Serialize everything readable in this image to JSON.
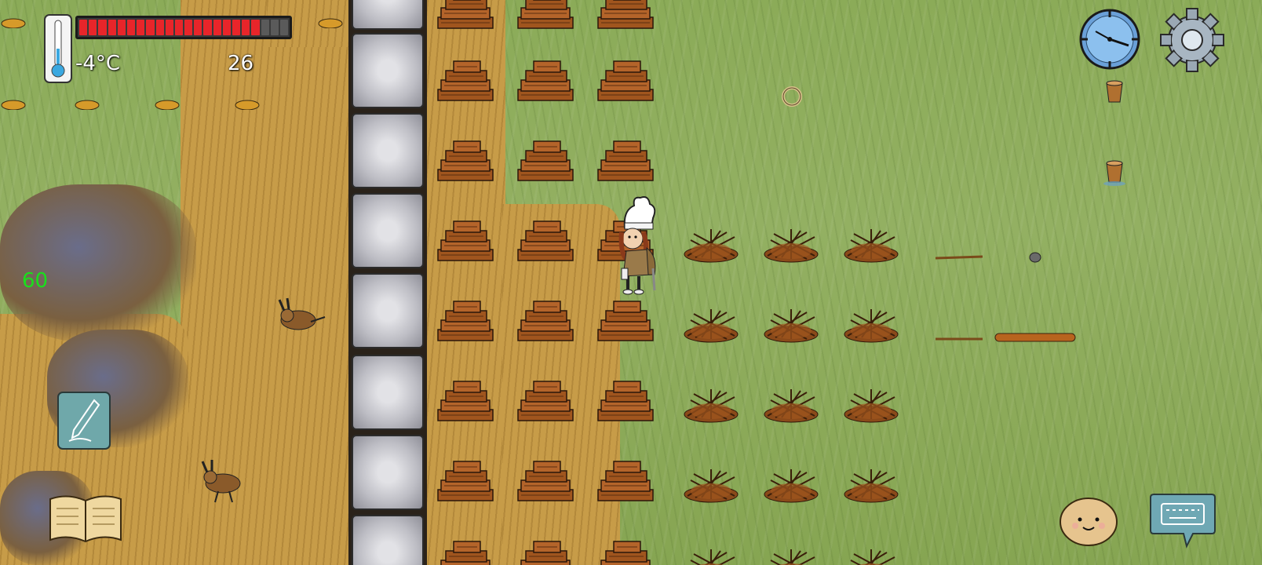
{
  "hud": {
    "temperature": "-4°C",
    "food_count": "26",
    "fps": "60",
    "health_fraction": 0.86,
    "health_segments_total": 22,
    "health_segments_filled": 19
  },
  "icons": {
    "thermometer": "thermometer-icon",
    "compass": "compass-icon",
    "settings": "gear-icon",
    "notes": "pencil-note-icon",
    "recipe_book": "open-book-icon",
    "emote": "potato-face-icon",
    "keyboard": "keyboard-chat-icon"
  },
  "colors": {
    "health": "#e8252a",
    "fps": "#19e01c",
    "grass": "#8bab58",
    "dirt": "#c79c48",
    "stone": "#d8d8de"
  }
}
